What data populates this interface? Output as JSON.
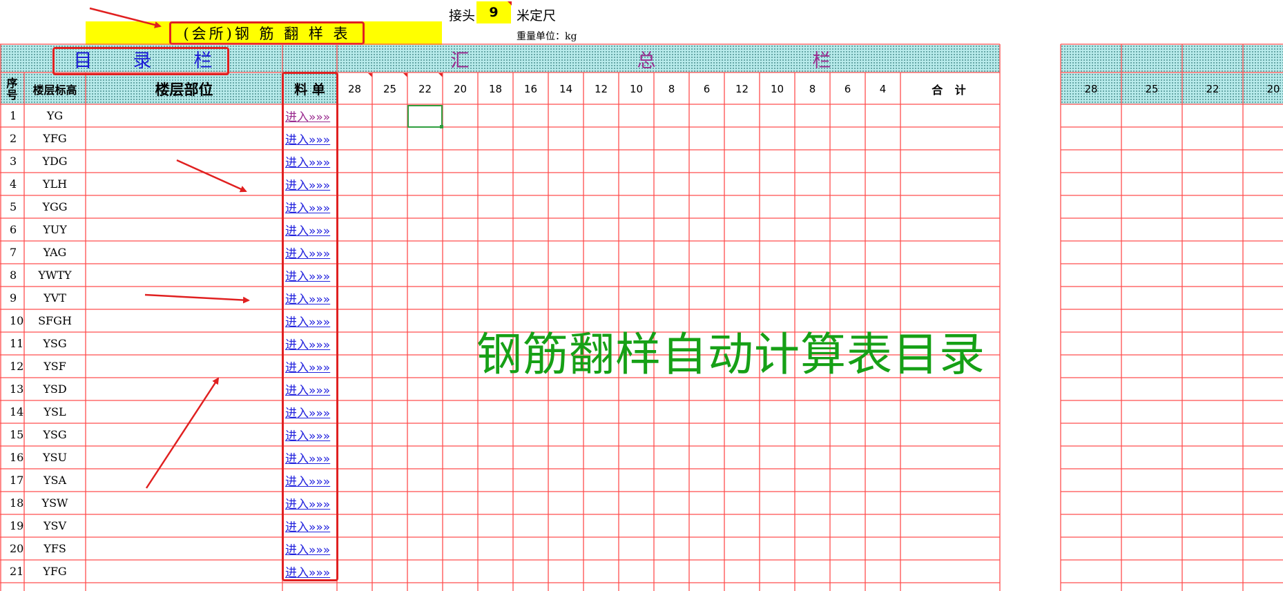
{
  "header": {
    "title": "(会所)钢 筋 翻 样 表",
    "joint_label": "接头",
    "joint_value": "9",
    "joint_unit": "米定尺",
    "weight_unit": "重量单位：kg"
  },
  "bands": {
    "catalog": [
      "目",
      "录",
      "栏"
    ],
    "summary": [
      "汇",
      "总",
      "栏"
    ]
  },
  "columns": {
    "seq": [
      "序",
      "号"
    ],
    "floor": "楼层标高",
    "part": "楼层部位",
    "sheet": "料 单",
    "sizes": [
      "28",
      "25",
      "22",
      "20",
      "18",
      "16",
      "14",
      "12",
      "10",
      "8",
      "6",
      "12",
      "10",
      "8",
      "6",
      "4"
    ],
    "total": "合  计",
    "right_sizes": [
      "28",
      "25",
      "22",
      "20"
    ]
  },
  "rows": [
    {
      "no": "1",
      "code": "YG",
      "link": "进入»»»",
      "visited": true
    },
    {
      "no": "2",
      "code": "YFG",
      "link": "进入»»»"
    },
    {
      "no": "3",
      "code": "YDG",
      "link": "进入»»»"
    },
    {
      "no": "4",
      "code": "YLH",
      "link": "进入»»»"
    },
    {
      "no": "5",
      "code": "YGG",
      "link": "进入»»»"
    },
    {
      "no": "6",
      "code": "YUY",
      "link": "进入»»»"
    },
    {
      "no": "7",
      "code": "YAG",
      "link": "进入»»»"
    },
    {
      "no": "8",
      "code": "YWTY",
      "link": "进入»»»"
    },
    {
      "no": "9",
      "code": "YVT",
      "link": "进入»»»"
    },
    {
      "no": "10",
      "code": "SFGH",
      "link": "进入»»»"
    },
    {
      "no": "11",
      "code": "YSG",
      "link": "进入»»»"
    },
    {
      "no": "12",
      "code": "YSF",
      "link": "进入»»»"
    },
    {
      "no": "13",
      "code": "YSD",
      "link": "进入»»»"
    },
    {
      "no": "14",
      "code": "YSL",
      "link": "进入»»»"
    },
    {
      "no": "15",
      "code": "YSG",
      "link": "进入»»»"
    },
    {
      "no": "16",
      "code": "YSU",
      "link": "进入»»»"
    },
    {
      "no": "17",
      "code": "YSA",
      "link": "进入»»»"
    },
    {
      "no": "18",
      "code": "YSW",
      "link": "进入»»»"
    },
    {
      "no": "19",
      "code": "YSV",
      "link": "进入»»»"
    },
    {
      "no": "20",
      "code": "YFS",
      "link": "进入»»»"
    },
    {
      "no": "21",
      "code": "YFG",
      "link": "进入»»»"
    }
  ],
  "watermark": "钢筋翻样自动计算表目录",
  "colors": {
    "grid": "#ff4d4d",
    "accent": "#e02020",
    "link": "#2222dd",
    "highlight": "#ffff00",
    "watermark": "#16a016"
  }
}
